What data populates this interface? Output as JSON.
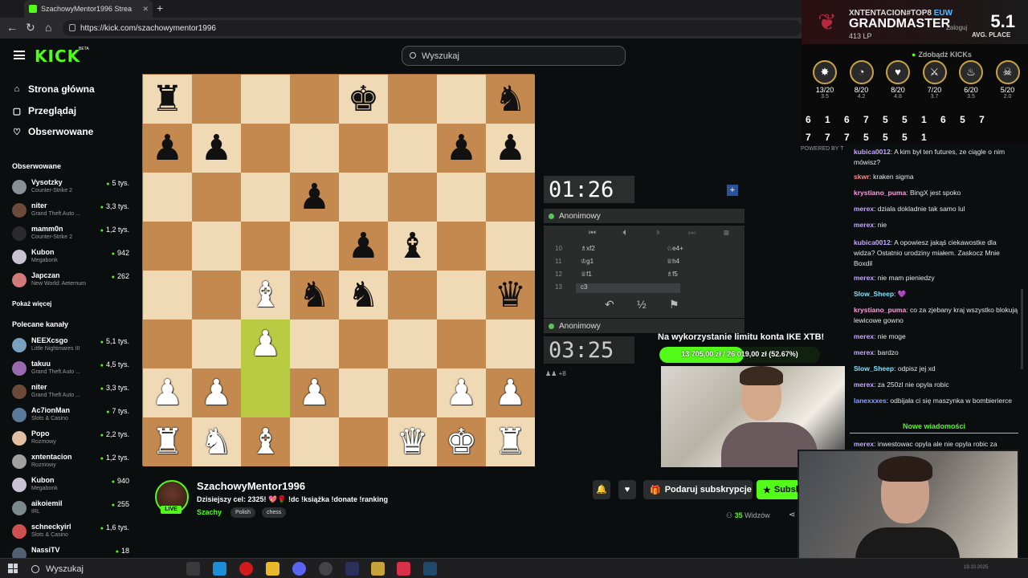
{
  "browser": {
    "tab_title": "SzachowyMentor1996 Strea",
    "url": "https://kick.com/szachowymentor1996"
  },
  "kick": {
    "logo": "KICK",
    "beta": "BETA",
    "search_placeholder": "Wyszukaj",
    "nav": [
      {
        "label": "Strona główna",
        "icon": "home-icon"
      },
      {
        "label": "Przeglądaj",
        "icon": "browse-icon"
      },
      {
        "label": "Obserwowane",
        "icon": "heart-icon"
      }
    ],
    "followed_title": "Obserwowane",
    "followed": [
      {
        "name": "Vysotzky",
        "game": "Counter-Strike 2",
        "viewers": "5 tys.",
        "color": "#8a8f95"
      },
      {
        "name": "niter",
        "game": "Grand Theft Auto ...",
        "viewers": "3,3 tys.",
        "color": "#6b4a3a"
      },
      {
        "name": "mamm0n",
        "game": "Counter-Strike 2",
        "viewers": "1,2 tys.",
        "color": "#2a2a2a"
      },
      {
        "name": "Kubon",
        "game": "Megabonk",
        "viewers": "942",
        "color": "#c9c2d2"
      },
      {
        "name": "Japczan",
        "game": "New World: Aeternum",
        "viewers": "262",
        "color": "#d07a7a"
      }
    ],
    "show_more": "Pokaż więcej",
    "recommended_title": "Polecane kanały",
    "recommended": [
      {
        "name": "NEEXcsgo",
        "game": "Little Nightmares III",
        "viewers": "5,1 tys.",
        "color": "#7aa0c0"
      },
      {
        "name": "takuu",
        "game": "Grand Theft Auto ...",
        "viewers": "4,5 tys.",
        "color": "#9a6ab0"
      },
      {
        "name": "niter",
        "game": "Grand Theft Auto ...",
        "viewers": "3,3 tys.",
        "color": "#6b4a3a"
      },
      {
        "name": "Ac7ionMan",
        "game": "Slots & Casino",
        "viewers": "7 tys.",
        "color": "#5a7a9a"
      },
      {
        "name": "Popo",
        "game": "Rozmowy",
        "viewers": "2,2 tys.",
        "color": "#e0c0a0"
      },
      {
        "name": "xntentacion",
        "game": "Rozmowy",
        "viewers": "1,2 tys.",
        "color": "#a0a0a0"
      },
      {
        "name": "Kubon",
        "game": "Megabonk",
        "viewers": "940",
        "color": "#c9c2d2"
      },
      {
        "name": "aikoiemil",
        "game": "IRL",
        "viewers": "255",
        "color": "#7a8a8a"
      },
      {
        "name": "schneckyirl",
        "game": "Slots & Casino",
        "viewers": "1,6 tys.",
        "color": "#d05050"
      },
      {
        "name": "NassiTV",
        "game": "",
        "viewers": "18",
        "color": "#506070"
      }
    ]
  },
  "chess": {
    "board": [
      [
        "br",
        "",
        "",
        "",
        "bk",
        "",
        "",
        "bn"
      ],
      [
        "bp",
        "bp",
        "",
        "",
        "",
        "",
        "bp",
        "bp"
      ],
      [
        "",
        "",
        "",
        "bp",
        "",
        "",
        "",
        ""
      ],
      [
        "",
        "",
        "",
        "",
        "bp",
        "bb",
        "",
        ""
      ],
      [
        "",
        "",
        "wb",
        "bn",
        "bn",
        "",
        "",
        "bq"
      ],
      [
        "",
        "",
        "wp",
        "",
        "",
        "",
        "",
        ""
      ],
      [
        "wp",
        "wp",
        "",
        "wp",
        "",
        "",
        "wp",
        "wp"
      ],
      [
        "wr",
        "wn",
        "wb",
        "",
        "",
        "wq",
        "wk",
        "wr"
      ]
    ],
    "highlight": [
      "5-2",
      "6-2"
    ],
    "top_timer": "01:26",
    "bottom_timer": "03:25",
    "top_player": "Anonimowy",
    "bottom_player": "Anonimowy",
    "moves": [
      {
        "n": "10",
        "w": "♗xf2",
        "b": "♘e4+"
      },
      {
        "n": "11",
        "w": "♔g1",
        "b": "♕h4"
      },
      {
        "n": "12",
        "w": "♕f1",
        "b": "♗f5"
      },
      {
        "n": "13",
        "w": "c3",
        "b": ""
      }
    ],
    "controls": {
      "first": "⏮",
      "prev": "⏮",
      "next": "⏭",
      "last": "⏭",
      "menu": "≡",
      "undo": "↶",
      "draw": "½",
      "resign": "⚑"
    },
    "captured": "♟♟ +8"
  },
  "overlay": {
    "ike_title": "Na wykorzystanie limitu konta IKE XTB!",
    "ike_text": "13 705,00 zł / 26 019,00 zł (52.67%)",
    "ike_progress": 52.67
  },
  "stream": {
    "name": "SzachowyMentor1996",
    "live": "LIVE",
    "title": "Dzisiejszy cel: 2325! 💖🌹 !dc !książka !donate !ranking",
    "category": "Szachy",
    "tags": [
      "Polish",
      "chess"
    ],
    "gift_label": "Podaruj subskrypcje",
    "sub_label": "Subskr",
    "viewers": "35",
    "viewers_label": "Widzów"
  },
  "tft": {
    "name": "XNTENTACION#TOP8",
    "region": "EUW",
    "rank": "GRANDMASTER",
    "lp": "413 LP",
    "avg": "5.1",
    "avg_label": "AVG. PLACE",
    "login": "Zaloguj",
    "zdobadz": "Zdobądź KICKs",
    "stats": [
      {
        "icon": "✸",
        "score": "13/20",
        "sub": "3.5"
      },
      {
        "icon": "◔",
        "score": "8/20",
        "sub": "4.2"
      },
      {
        "icon": "♥",
        "score": "8/20",
        "sub": "4.8"
      },
      {
        "icon": "⚔",
        "score": "7/20",
        "sub": "3.7"
      },
      {
        "icon": "♨",
        "score": "6/20",
        "sub": "3.5"
      },
      {
        "icon": "☠",
        "score": "5/20",
        "sub": "2.0"
      }
    ],
    "placements": "6 1 6 7 5 5 1 6 5 7 7 7 7 5 5 5 1",
    "powered": "POWERED BY T"
  },
  "chat": {
    "messages": [
      {
        "user": "kubica0012",
        "color": "#c7a8ff",
        "text": "A kim był ten futures, ze ciągle o nim mówisz?"
      },
      {
        "user": "skwr",
        "color": "#ff8a8a",
        "text": "kraken sigma"
      },
      {
        "user": "krystiano_puma",
        "color": "#ff9de0",
        "text": "BingX jest spoko"
      },
      {
        "user": "merex",
        "color": "#c7a8ff",
        "text": "dziala dokladnie tak samo lul"
      },
      {
        "user": "merex",
        "color": "#c7a8ff",
        "text": "nie"
      },
      {
        "user": "kubica0012",
        "color": "#c7a8ff",
        "text": "A opowiesz jakąś ciekawostke dla widza? Ostatnio urodziny miałem. Zaskocz Mnie Boxdil"
      },
      {
        "user": "merex",
        "color": "#c7a8ff",
        "text": "nie mam pieniedzy"
      },
      {
        "user": "Slow_Sheep",
        "color": "#7ce3ff",
        "text": "💜"
      },
      {
        "user": "krystiano_puma",
        "color": "#ff9de0",
        "text": "co za zjebany kraj wszystko blokują lewicowe gowno"
      },
      {
        "user": "merex",
        "color": "#c7a8ff",
        "text": "nie moge"
      },
      {
        "user": "merex",
        "color": "#c7a8ff",
        "text": "bardzo"
      },
      {
        "user": "Slow_Sheep",
        "color": "#7ce3ff",
        "text": "odpisz jej xd"
      },
      {
        "user": "merex",
        "color": "#c7a8ff",
        "text": "za 250zl nie opyla robic"
      },
      {
        "user": "lanexxxes",
        "color": "#8aa2ff",
        "text": "odbijała ci się maszynka w bombierierce"
      }
    ],
    "new_messages": "Nowe wiadomości",
    "last": {
      "user": "merex",
      "color": "#c7a8ff",
      "text": "inwestowac opyla ale nie opyla robic za"
    }
  },
  "taskbar": {
    "search": "Wyszukaj",
    "date": "19.10.2025"
  }
}
